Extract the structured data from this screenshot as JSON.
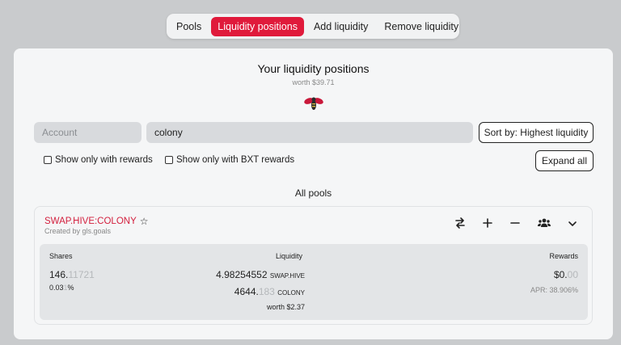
{
  "tabs": [
    {
      "label": "Pools",
      "active": false
    },
    {
      "label": "Liquidity positions",
      "active": true
    },
    {
      "label": "Add liquidity",
      "active": false
    },
    {
      "label": "Remove liquidity",
      "active": false
    }
  ],
  "header": {
    "title": "Your liquidity positions",
    "worth": "worth $39.71"
  },
  "filters": {
    "account_placeholder": "Account",
    "search_value": "colony",
    "sort_label": "Sort by: Highest liquidity",
    "show_rewards_label": "Show only with rewards",
    "show_bxt_label": "Show only with BXT rewards",
    "expand_label": "Expand all"
  },
  "section_title": "All pools",
  "pool": {
    "name": "SWAP.HIVE:COLONY",
    "creator": "Created by gls.goals",
    "shares_header": "Shares",
    "shares_main": "146.",
    "shares_dim": "11721",
    "share_pct_main": "0.03",
    "share_pct_dim": "1",
    "share_pct_unit": "%",
    "liquidity_header": "Liquidity",
    "liq1_value": "4.98254552",
    "liq1_token": "SWAP.HIVE",
    "liq2_main": "4644.",
    "liq2_dim": "183",
    "liq2_token": "COLONY",
    "liq_worth": "worth $2.37",
    "rewards_header": "Rewards",
    "rewards_main": "$0.",
    "rewards_dim": "00",
    "apr": "APR: 38.906%"
  },
  "icons": {
    "swap": "swap-icon",
    "add": "plus-icon",
    "remove": "minus-icon",
    "users": "users-icon",
    "expand": "chevron-down-icon"
  },
  "colors": {
    "accent": "#e01a3b",
    "pool_name": "#d3203e"
  }
}
